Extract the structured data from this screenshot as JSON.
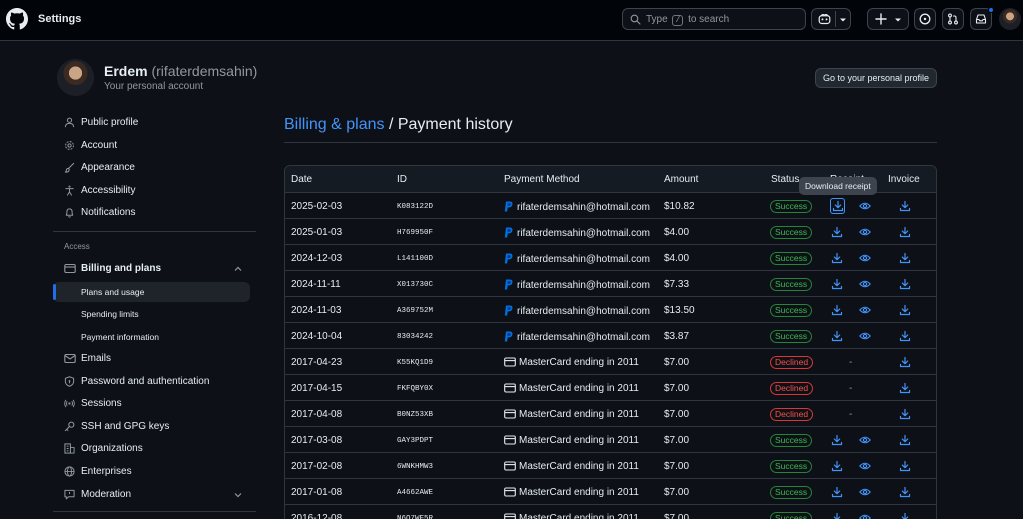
{
  "header": {
    "title": "Settings",
    "search_prefix": "Type",
    "search_key": "/",
    "search_suffix": "to search"
  },
  "profile": {
    "name": "Erdem",
    "login": "(rifaterdemsahin)",
    "subtitle": "Your personal account",
    "profile_button": "Go to your personal profile"
  },
  "sidebar": {
    "items": [
      {
        "label": "Public profile",
        "icon": "person-icon"
      },
      {
        "label": "Account",
        "icon": "gear-icon"
      },
      {
        "label": "Appearance",
        "icon": "paintbrush-icon"
      },
      {
        "label": "Accessibility",
        "icon": "accessibility-icon"
      },
      {
        "label": "Notifications",
        "icon": "bell-icon"
      }
    ],
    "access_heading": "Access",
    "billing": {
      "label": "Billing and plans",
      "icon": "credit-card-icon"
    },
    "billing_sub": [
      "Plans and usage",
      "Spending limits",
      "Payment information"
    ],
    "items2": [
      {
        "label": "Emails",
        "icon": "mail-icon"
      },
      {
        "label": "Password and authentication",
        "icon": "shield-lock-icon"
      },
      {
        "label": "Sessions",
        "icon": "broadcast-icon"
      },
      {
        "label": "SSH and GPG keys",
        "icon": "key-icon"
      },
      {
        "label": "Organizations",
        "icon": "organization-icon"
      },
      {
        "label": "Enterprises",
        "icon": "globe-icon"
      },
      {
        "label": "Moderation",
        "icon": "report-icon"
      }
    ]
  },
  "page": {
    "breadcrumb_link": "Billing & plans",
    "breadcrumb_sep": "/",
    "breadcrumb_current": "Payment history"
  },
  "table": {
    "columns": {
      "date": "Date",
      "id": "ID",
      "method": "Payment Method",
      "amount": "Amount",
      "status": "Status",
      "receipt": "Receipt",
      "invoice": "Invoice"
    },
    "tooltip": "Download receipt",
    "rows": [
      {
        "date": "2025-02-03",
        "id": "K083122D",
        "method": "rifaterdemsahin@hotmail.com",
        "method_type": "paypal",
        "amount": "$10.82",
        "status": "Success"
      },
      {
        "date": "2025-01-03",
        "id": "H769950F",
        "method": "rifaterdemsahin@hotmail.com",
        "method_type": "paypal",
        "amount": "$4.00",
        "status": "Success"
      },
      {
        "date": "2024-12-03",
        "id": "L141100D",
        "method": "rifaterdemsahin@hotmail.com",
        "method_type": "paypal",
        "amount": "$4.00",
        "status": "Success"
      },
      {
        "date": "2024-11-11",
        "id": "X013730C",
        "method": "rifaterdemsahin@hotmail.com",
        "method_type": "paypal",
        "amount": "$7.33",
        "status": "Success"
      },
      {
        "date": "2024-11-03",
        "id": "A369752M",
        "method": "rifaterdemsahin@hotmail.com",
        "method_type": "paypal",
        "amount": "$13.50",
        "status": "Success"
      },
      {
        "date": "2024-10-04",
        "id": "83034242",
        "method": "rifaterdemsahin@hotmail.com",
        "method_type": "paypal",
        "amount": "$3.87",
        "status": "Success"
      },
      {
        "date": "2017-04-23",
        "id": "K55KQ1D9",
        "method": "MasterCard ending in 2011",
        "method_type": "card",
        "amount": "$7.00",
        "status": "Declined"
      },
      {
        "date": "2017-04-15",
        "id": "FKFQBY0X",
        "method": "MasterCard ending in 2011",
        "method_type": "card",
        "amount": "$7.00",
        "status": "Declined"
      },
      {
        "date": "2017-04-08",
        "id": "B0NZ53XB",
        "method": "MasterCard ending in 2011",
        "method_type": "card",
        "amount": "$7.00",
        "status": "Declined"
      },
      {
        "date": "2017-03-08",
        "id": "GAY3PDPT",
        "method": "MasterCard ending in 2011",
        "method_type": "card",
        "amount": "$7.00",
        "status": "Success"
      },
      {
        "date": "2017-02-08",
        "id": "6WNKHMW3",
        "method": "MasterCard ending in 2011",
        "method_type": "card",
        "amount": "$7.00",
        "status": "Success"
      },
      {
        "date": "2017-01-08",
        "id": "A4662AWE",
        "method": "MasterCard ending in 2011",
        "method_type": "card",
        "amount": "$7.00",
        "status": "Success"
      },
      {
        "date": "2016-12-08",
        "id": "N6Q7WF5R",
        "method": "MasterCard ending in 2011",
        "method_type": "card",
        "amount": "$7.00",
        "status": "Success"
      }
    ]
  },
  "colors": {
    "accent": "#4493f8",
    "success": "#3fb950",
    "danger": "#f85149",
    "background": "#0d1117"
  }
}
